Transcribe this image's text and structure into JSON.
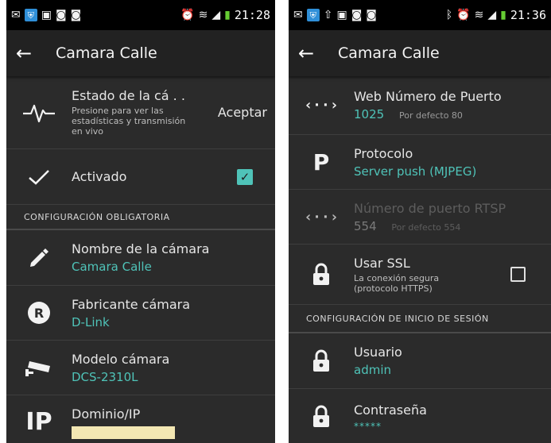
{
  "left": {
    "status": {
      "time": "21:28"
    },
    "appbar": {
      "title": "Camara Calle"
    },
    "status_row": {
      "title": "Estado de la cá . .",
      "sub": "Presione para ver las estadísticas y transmisión en vivo",
      "button": "Aceptar"
    },
    "activated_row": {
      "title": "Activado",
      "checked": true
    },
    "section": "CONFIGURACIÓN OBLIGATORIA",
    "name_row": {
      "title": "Nombre de la cámara",
      "value": "Camara Calle"
    },
    "maker_row": {
      "title": "Fabricante cámara",
      "value": "D-Link"
    },
    "model_row": {
      "title": "Modelo cámara",
      "value": "DCS-2310L"
    },
    "ip_row": {
      "title": "Dominio/IP",
      "icon_text": "IP"
    }
  },
  "right": {
    "status": {
      "time": "21:36"
    },
    "appbar": {
      "title": "Camara Calle"
    },
    "web_port_row": {
      "title": "Web Número de Puerto",
      "value": "1025",
      "hint": "Por defecto 80",
      "icon_text": "‹··›"
    },
    "protocol_row": {
      "title": "Protocolo",
      "value": "Server push (MJPEG)",
      "icon_text": "P"
    },
    "rtsp_row": {
      "title": "Número de puerto RTSP",
      "value": "554",
      "hint": "Por defecto 554",
      "icon_text": "‹··›"
    },
    "ssl_row": {
      "title": "Usar SSL",
      "sub": "La conexión segura (protocolo HTTPS)",
      "checked": false
    },
    "section": "CONFIGURACIÓN DE INICIO DE SESIÓN",
    "user_row": {
      "title": "Usuario",
      "value": "admin"
    },
    "password_row": {
      "title": "Contraseña",
      "value": "*****"
    }
  },
  "colors": {
    "accent": "#4fc3b8",
    "background": "#2b2b2b",
    "appbar": "#222222",
    "ip_field": "#f3e7b3"
  }
}
